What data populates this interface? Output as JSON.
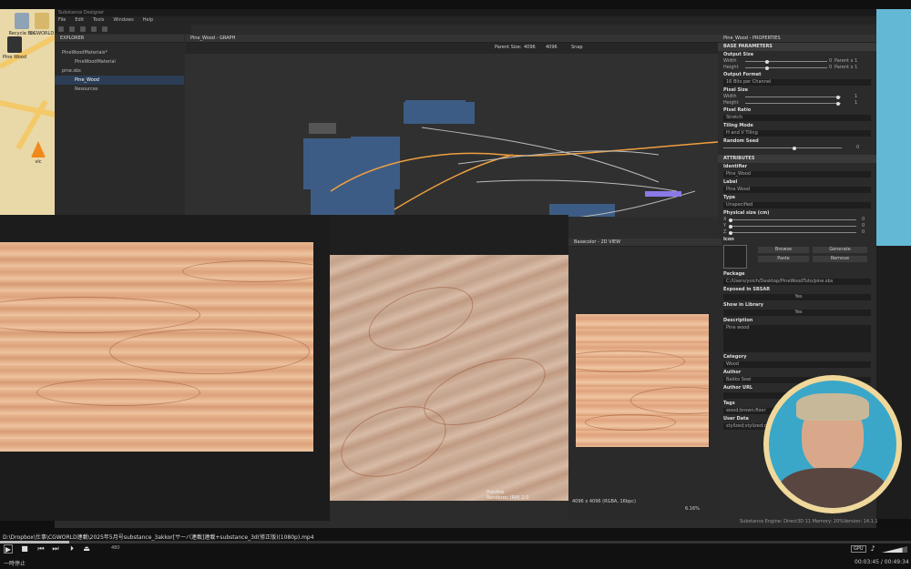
{
  "app": {
    "title": "Substance Designer",
    "menu": [
      "File",
      "Edit",
      "Tools",
      "Windows",
      "Help"
    ]
  },
  "desktop": {
    "icons": [
      {
        "label": "Recycle Bin",
        "icon": "recycle-bin-icon"
      },
      {
        "label": "CGWORLD",
        "icon": "folder-icon"
      },
      {
        "label": "Pine Wood",
        "icon": "file-icon"
      },
      {
        "label": "vlc",
        "icon": "vlc-icon"
      }
    ]
  },
  "explorer": {
    "title": "EXPLORER",
    "items": [
      {
        "label": "PineWoodMaterials*",
        "level": 0
      },
      {
        "label": "PineWoodMaterial",
        "level": 1
      },
      {
        "label": "pine.sbs",
        "level": 0
      },
      {
        "label": "Pine_Wood",
        "level": 1,
        "selected": true
      },
      {
        "label": "Resources",
        "level": 1
      }
    ]
  },
  "graph": {
    "title": "Pine_Wood - GRAPH",
    "parent_size_label": "Parent Size:",
    "parent_size_w": "4096",
    "parent_size_h": "4096",
    "snap_label": "Snap"
  },
  "properties": {
    "title": "Pine_Wood - PROPERTIES",
    "base_params_title": "BASE PARAMETERS",
    "output_size": {
      "label": "Output Size",
      "width_label": "Width",
      "height_label": "Height",
      "width_value": "Parent x 1",
      "height_value": "Parent x 1",
      "width_num": "0",
      "height_num": "0"
    },
    "output_format": {
      "label": "Output Format",
      "value": "16 Bits per Channel"
    },
    "pixel_size": {
      "label": "Pixel Size",
      "width_label": "Width",
      "height_label": "Height",
      "width_value": "1",
      "height_value": "1"
    },
    "pixel_ratio": {
      "label": "Pixel Ratio",
      "value": "Stretch"
    },
    "tiling_mode": {
      "label": "Tiling Mode",
      "value": "H and V Tiling"
    },
    "random_seed": {
      "label": "Random Seed",
      "value": "0"
    },
    "attributes_title": "ATTRIBUTES",
    "identifier": {
      "label": "Identifier",
      "value": "Pine_Wood"
    },
    "label": {
      "label": "Label",
      "value": "Pine Wood"
    },
    "type": {
      "label": "Type",
      "value": "Unspecified"
    },
    "physical_size": {
      "label": "Physical size (cm)",
      "rows": [
        {
          "axis": "X",
          "value": "0"
        },
        {
          "axis": "Y",
          "value": "0"
        },
        {
          "axis": "Z",
          "value": "0"
        }
      ]
    },
    "icon": {
      "label": "Icon",
      "browse": "Browse",
      "generate": "Generate",
      "paste": "Paste",
      "remove": "Remove"
    },
    "package": {
      "label": "Package",
      "value": "C:/Users/yoich/Desktop/PineWoodTuto/pine.sbs"
    },
    "exposed": {
      "label": "Exposed in SBSAR",
      "value": "Yes"
    },
    "show_library": {
      "label": "Show in Library",
      "value": "Yes"
    },
    "description": {
      "label": "Description",
      "value": "Pine wood"
    },
    "category": {
      "label": "Category",
      "value": "Wood"
    },
    "author": {
      "label": "Author",
      "value": "Bakko Soei"
    },
    "author_url": {
      "label": "Author URL",
      "value": ""
    },
    "tags": {
      "label": "Tags",
      "value": "wood;brown;floor"
    },
    "user_data": {
      "label": "User Data",
      "value": "stylized;stylized;customizer;stylized"
    }
  },
  "view2d": {
    "title": "Basecolor - 2D VIEW",
    "info": "4096 x 4096 (RGBA, 16bpc)",
    "zoom": "6.16%"
  },
  "view3d": {
    "label1": "Preview",
    "label2": "Renderer: IRAY 2.0"
  },
  "status": {
    "engine": "Substance Engine: Direct3D 11  Memory: 20%",
    "version": "Version: 14.1.1"
  },
  "player": {
    "file_path": "D:\\Dropbox\\仕事\\CGWORLD連載\\2025年5月号substance_3akkor[サーバ連載]連載+substance_3d(修正版)(1080p).mp4",
    "status_text": "一時停止",
    "time": "00:03:45 / 00:49:34",
    "gpu_label": "GPU",
    "speed_label": "480"
  }
}
